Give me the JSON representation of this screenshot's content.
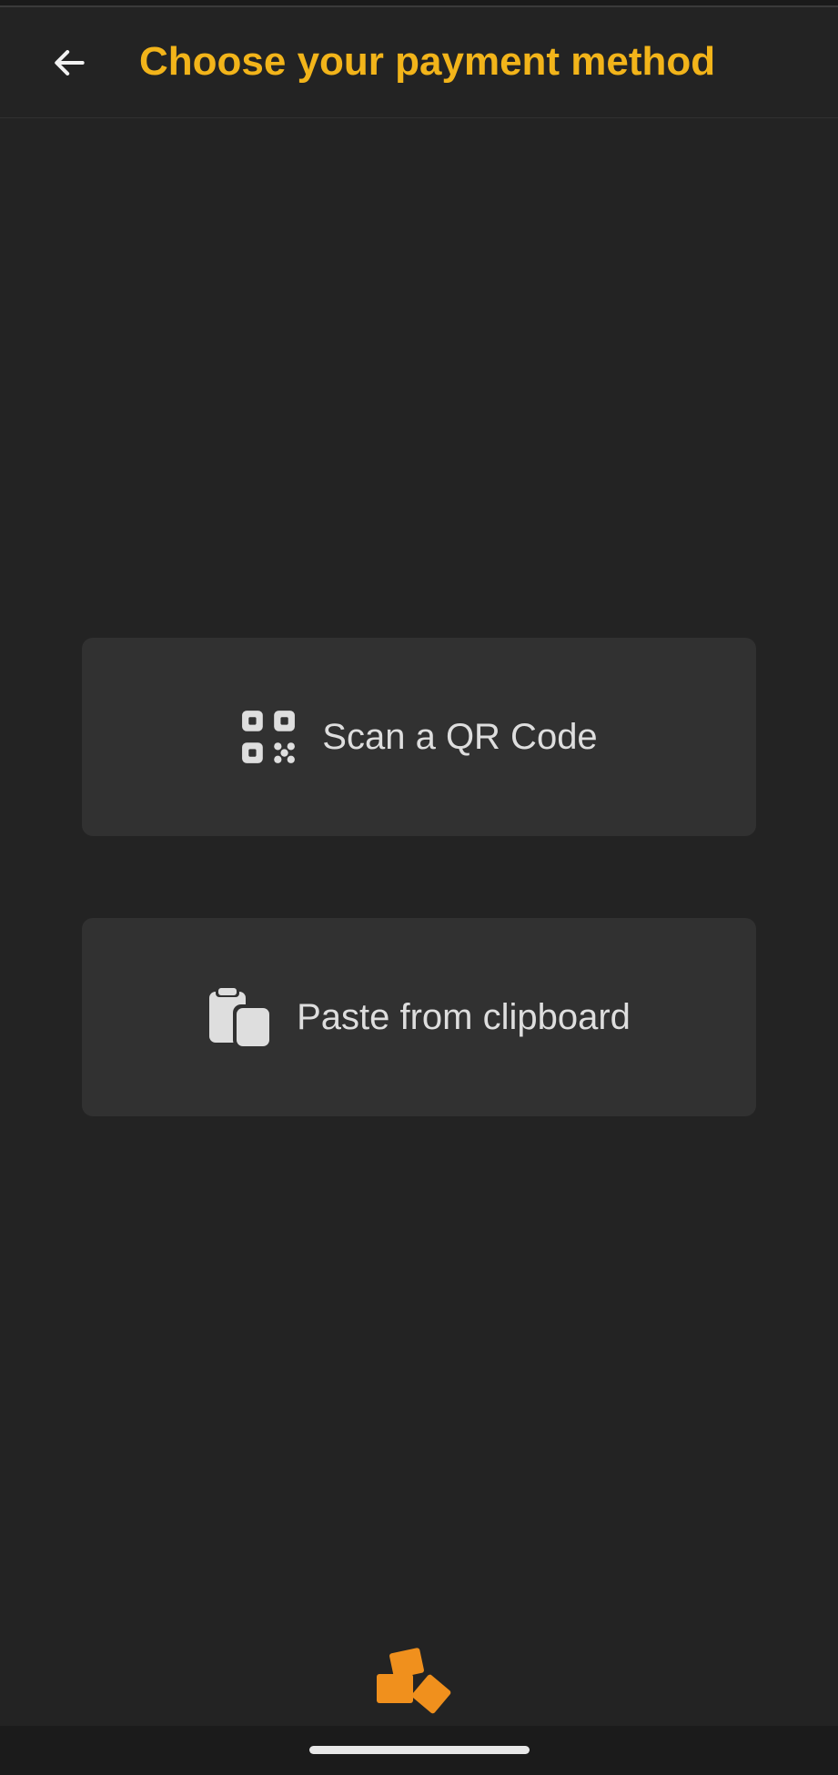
{
  "theme": {
    "background": "#232323",
    "surface": "#313131",
    "accent": "#f2b41a",
    "text": "#dedede",
    "brand_orange": "#f0901d"
  },
  "header": {
    "back_icon": "arrow-left-icon",
    "title": "Choose your payment method"
  },
  "options": {
    "scan": {
      "icon": "qr-code-icon",
      "label": "Scan a QR Code"
    },
    "paste": {
      "icon": "clipboard-paste-icon",
      "label": "Paste from clipboard"
    }
  },
  "footer": {
    "logo_icon": "brand-cubes-icon"
  }
}
